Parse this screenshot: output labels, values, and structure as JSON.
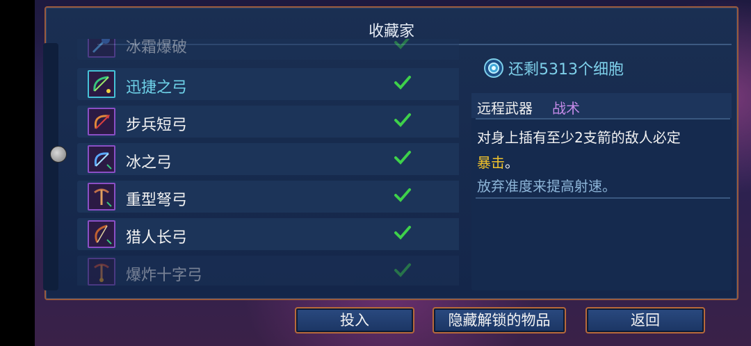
{
  "panel": {
    "title": "收藏家"
  },
  "items": [
    {
      "name": "冰霜爆破",
      "unlocked": true
    },
    {
      "name": "迅捷之弓",
      "unlocked": true,
      "selected": true
    },
    {
      "name": "步兵短弓",
      "unlocked": true
    },
    {
      "name": "冰之弓",
      "unlocked": true
    },
    {
      "name": "重型弩弓",
      "unlocked": true
    },
    {
      "name": "猎人长弓",
      "unlocked": true
    },
    {
      "name": "爆炸十字弓",
      "unlocked": true
    }
  ],
  "cells": {
    "remaining_text": "还剩5313个细胞"
  },
  "detail": {
    "type": "远程武器",
    "tag": "战术",
    "desc_line1": "对身上插有至少2支箭的敌人必定",
    "desc_crit": "暴击",
    "desc_end": "。",
    "note": "放弃准度来提高射速。"
  },
  "buttons": {
    "invest": "投入",
    "hide_unlocked": "隐藏解锁的物品",
    "back": "返回"
  },
  "colors": {
    "selected": "#6fd3e9",
    "crit": "#f0c22c",
    "tag": "#c48ae8",
    "check": "#3ed14a"
  }
}
